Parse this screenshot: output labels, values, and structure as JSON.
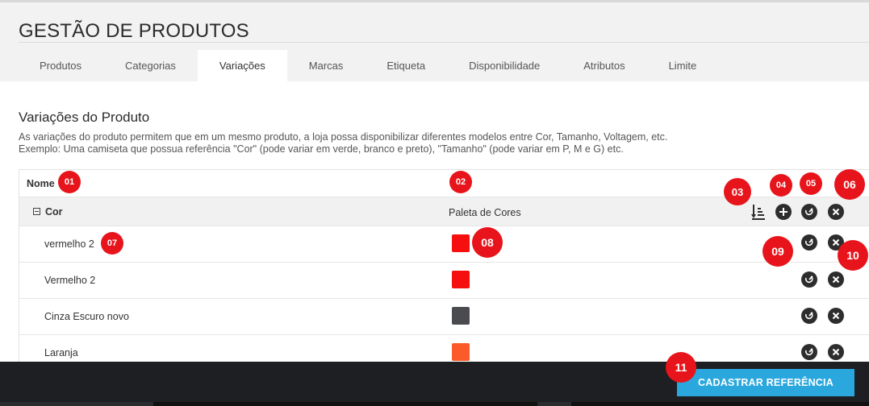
{
  "page": {
    "title": "GESTÃO DE PRODUTOS"
  },
  "tabs": [
    {
      "label": "Produtos"
    },
    {
      "label": "Categorias"
    },
    {
      "label": "Variações"
    },
    {
      "label": "Marcas"
    },
    {
      "label": "Etiqueta"
    },
    {
      "label": "Disponibilidade"
    },
    {
      "label": "Atributos"
    },
    {
      "label": "Limite"
    }
  ],
  "active_tab": "Variações",
  "section": {
    "title": "Variações do Produto",
    "description_line1": "As variações do produto permitem que em um mesmo produto, a loja possa disponibilizar diferentes modelos entre Cor, Tamanho, Voltagem, etc.",
    "description_line2": "Exemplo: Uma camiseta que possua referência \"Cor\" (pode variar em verde, branco e preto), \"Tamanho\" (pode variar em P, M e G) etc."
  },
  "table": {
    "header": {
      "name_label": "Nome"
    },
    "group": {
      "name": "Cor",
      "type": "Paleta de Cores"
    },
    "items": [
      {
        "name": "vermelho 2",
        "color": "#f50f0f"
      },
      {
        "name": "Vermelho 2",
        "color": "#f50f0f"
      },
      {
        "name": "Cinza Escuro novo",
        "color": "#4a4b4f"
      },
      {
        "name": "Laranja",
        "color": "#fb5a2a"
      }
    ]
  },
  "badges": {
    "b01": "01",
    "b02": "02",
    "b03": "03",
    "b04": "04",
    "b05": "05",
    "b06": "06",
    "b07": "07",
    "b08": "08",
    "b09": "09",
    "b10": "10",
    "b11": "11"
  },
  "footer": {
    "cta_label": "CADASTRAR REFERÊNCIA"
  },
  "icons": {
    "sort": "sort-icon",
    "add": "plus-circle-icon",
    "edit": "edit-icon",
    "remove": "close-circle-icon",
    "collapse": "minus-square-icon"
  },
  "colors": {
    "accent": "#2aa7dd",
    "badge": "#e8141b",
    "footer": "#1d1f22"
  }
}
